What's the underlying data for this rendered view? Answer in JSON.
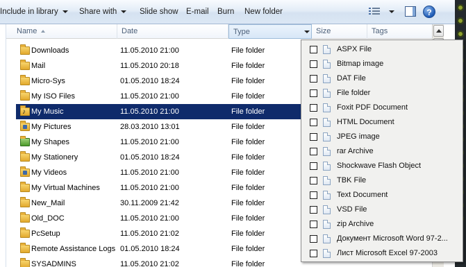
{
  "toolbar": {
    "include_in_library": "Include in library",
    "share_with": "Share with",
    "slide_show": "Slide show",
    "email": "E-mail",
    "burn": "Burn",
    "new_folder": "New folder"
  },
  "columns": {
    "name": "Name",
    "date": "Date",
    "type": "Type",
    "size": "Size",
    "tags": "Tags"
  },
  "files": [
    {
      "name": "Downloads",
      "date": "11.05.2010 21:00",
      "type": "File folder",
      "icon": "folder-icon"
    },
    {
      "name": "Mail",
      "date": "11.05.2010 20:18",
      "type": "File folder",
      "icon": "folder-icon"
    },
    {
      "name": "Micro-Sys",
      "date": "01.05.2010 18:24",
      "type": "File folder",
      "icon": "folder-icon"
    },
    {
      "name": "My ISO Files",
      "date": "11.05.2010 21:00",
      "type": "File folder",
      "icon": "folder-icon"
    },
    {
      "name": "My Music",
      "date": "11.05.2010 21:00",
      "type": "File folder",
      "icon": "music-folder-icon",
      "selected": true
    },
    {
      "name": "My Pictures",
      "date": "28.03.2010 13:01",
      "type": "File folder",
      "icon": "pictures-folder-icon"
    },
    {
      "name": "My Shapes",
      "date": "11.05.2010 21:00",
      "type": "File folder",
      "icon": "shapes-folder-icon"
    },
    {
      "name": "My Stationery",
      "date": "01.05.2010 18:24",
      "type": "File folder",
      "icon": "folder-icon"
    },
    {
      "name": "My Videos",
      "date": "11.05.2010 21:00",
      "type": "File folder",
      "icon": "videos-folder-icon"
    },
    {
      "name": "My Virtual Machines",
      "date": "11.05.2010 21:00",
      "type": "File folder",
      "icon": "folder-icon"
    },
    {
      "name": "New_Mail",
      "date": "30.11.2009 21:42",
      "type": "File folder",
      "icon": "folder-icon"
    },
    {
      "name": "Old_DOC",
      "date": "11.05.2010 21:00",
      "type": "File folder",
      "icon": "folder-icon"
    },
    {
      "name": "PcSetup",
      "date": "11.05.2010 21:02",
      "type": "File folder",
      "icon": "folder-icon"
    },
    {
      "name": "Remote Assistance Logs",
      "date": "01.05.2010 18:24",
      "type": "File folder",
      "icon": "folder-icon"
    },
    {
      "name": "SYSADMINS",
      "date": "11.05.2010 21:02",
      "type": "File folder",
      "icon": "folder-icon"
    }
  ],
  "type_filter": {
    "items": [
      "ASPX File",
      "Bitmap image",
      "DAT File",
      "File folder",
      "Foxit PDF Document",
      "HTML Document",
      "JPEG image",
      "rar Archive",
      "Shockwave Flash Object",
      "TBK File",
      "Text Document",
      "VSD File",
      "zip Archive",
      "Документ Microsoft Word 97-2...",
      "Лист Microsoft Excel 97-2003"
    ],
    "checked": [
      false,
      false,
      false,
      false,
      false,
      false,
      false,
      false,
      false,
      false,
      false,
      false,
      false,
      false,
      false
    ]
  },
  "colors": {
    "selection": "#0f2b6b",
    "toolbar_top": "#f8fbfe",
    "toolbar_bottom": "#dbe7f4",
    "header_text": "#4c607a",
    "popup_bg": "#f1f1ef"
  }
}
